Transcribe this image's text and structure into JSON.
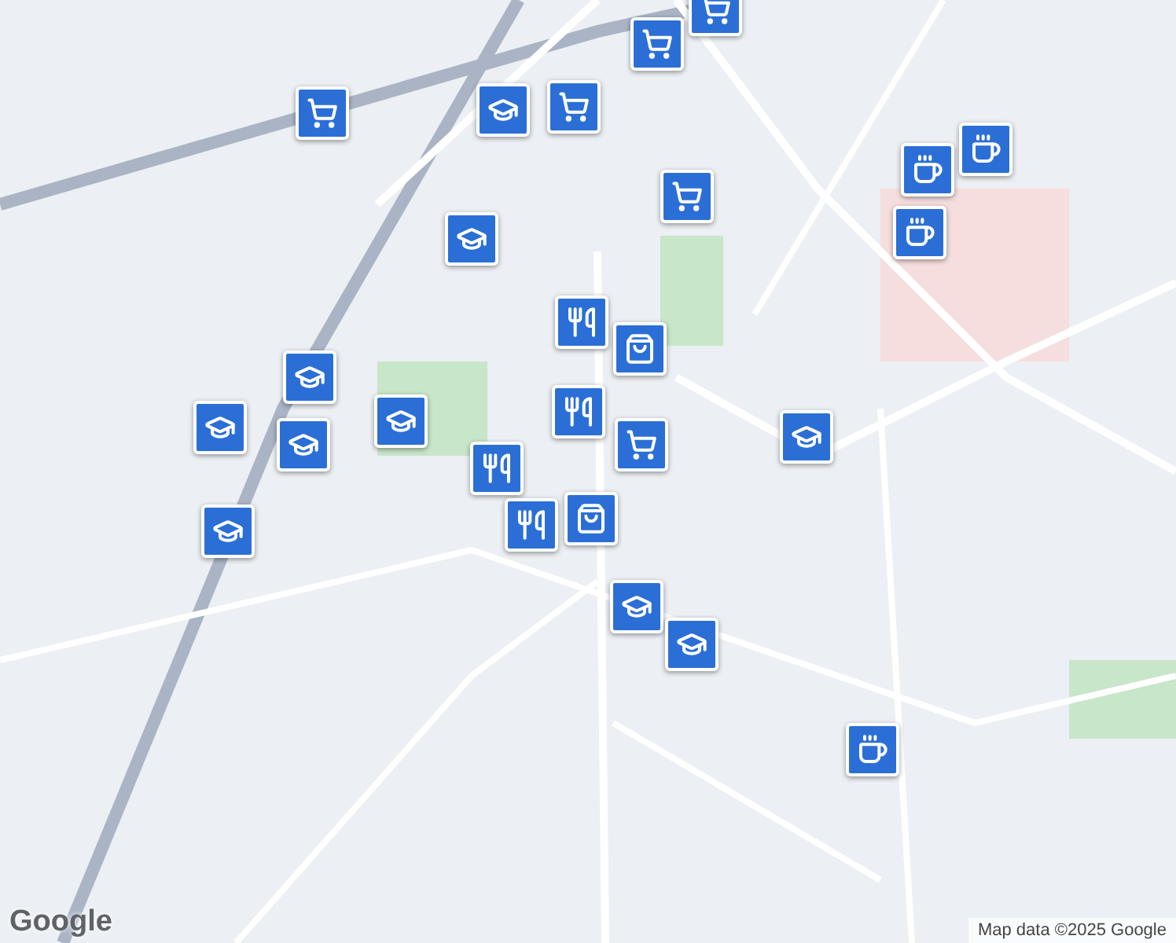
{
  "map": {
    "markers": [
      {
        "kind": "cart"
      },
      {
        "kind": "cart"
      },
      {
        "kind": "cart"
      },
      {
        "kind": "cart"
      },
      {
        "kind": "cart"
      },
      {
        "kind": "cart"
      },
      {
        "kind": "school"
      },
      {
        "kind": "school"
      },
      {
        "kind": "school"
      },
      {
        "kind": "school"
      },
      {
        "kind": "school"
      },
      {
        "kind": "school"
      },
      {
        "kind": "school"
      },
      {
        "kind": "school"
      },
      {
        "kind": "school"
      },
      {
        "kind": "school"
      },
      {
        "kind": "restaurant"
      },
      {
        "kind": "restaurant"
      },
      {
        "kind": "restaurant"
      },
      {
        "kind": "shop"
      },
      {
        "kind": "shop"
      },
      {
        "kind": "cafe"
      },
      {
        "kind": "cafe"
      },
      {
        "kind": "cafe"
      },
      {
        "kind": "cafe"
      },
      {
        "kind": "restaurant"
      }
    ]
  },
  "logo": "Google",
  "attribution": "Map data ©2025 Google"
}
